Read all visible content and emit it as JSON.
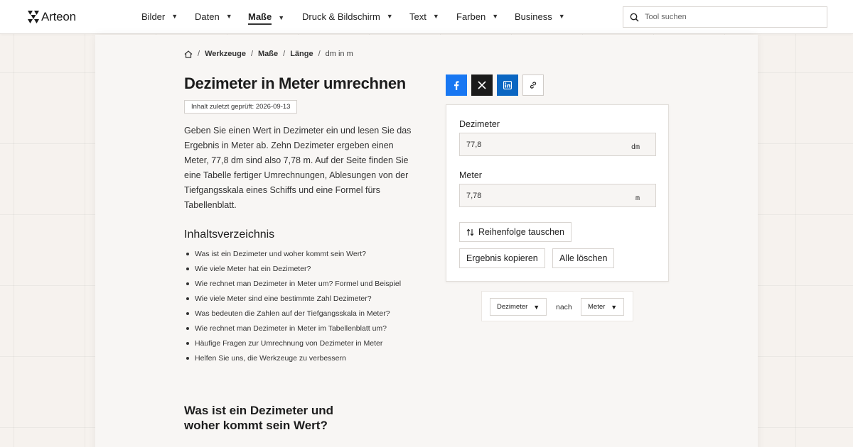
{
  "header": {
    "logo_text": "Arteon",
    "nav": [
      {
        "label": "Bilder",
        "active": false
      },
      {
        "label": "Daten",
        "active": false
      },
      {
        "label": "Maße",
        "active": true
      },
      {
        "label": "Druck & Bildschirm",
        "active": false
      },
      {
        "label": "Text",
        "active": false
      },
      {
        "label": "Farben",
        "active": false
      },
      {
        "label": "Business",
        "active": false
      }
    ],
    "search_placeholder": "Tool suchen"
  },
  "breadcrumb": [
    "Werkzeuge",
    "Maße",
    "Länge",
    "dm in m"
  ],
  "page": {
    "title": "Dezimeter in Meter umrechnen",
    "checked": "Inhalt zuletzt geprüft: 2026-09-13",
    "intro": "Geben Sie einen Wert in Dezimeter ein und lesen Sie das Ergebnis in Meter ab. Zehn Dezimeter ergeben einen Meter, 77,8 dm sind also 7,78 m. Auf der Seite finden Sie eine Tabelle fertiger Umrechnungen, Ablesungen von der Tiefgangsskala eines Schiffs und eine Formel fürs Tabellenblatt.",
    "toc_title": "Inhaltsverzeichnis",
    "toc": [
      "Was ist ein Dezimeter und woher kommt sein Wert?",
      "Wie viele Meter hat ein Dezimeter?",
      "Wie rechnet man Dezimeter in Meter um? Formel und Beispiel",
      "Wie viele Meter sind eine bestimmte Zahl Dezimeter?",
      "Was bedeuten die Zahlen auf der Tiefgangsskala in Meter?",
      "Wie rechnet man Dezimeter in Meter im Tabellenblatt um?",
      "Häufige Fragen zur Umrechnung von Dezimeter in Meter",
      "Helfen Sie uns, die Werkzeuge zu verbessern"
    ],
    "section_title": "Was ist ein Dezimeter und woher kommt sein Wert?"
  },
  "share": {
    "icons": [
      "facebook-icon",
      "x-icon",
      "linkedin-icon",
      "link-icon"
    ]
  },
  "converter": {
    "from_label": "Dezimeter",
    "from_value": "77,8",
    "from_unit": "dm",
    "to_label": "Meter",
    "to_value": "7,78",
    "to_unit": "m",
    "swap_label": "Reihenfolge tauschen",
    "copy_label": "Ergebnis kopieren",
    "clear_label": "Alle löschen"
  },
  "unit_selector": {
    "from": "Dezimeter",
    "connector": "nach",
    "to": "Meter"
  },
  "colors": {
    "facebook": "#1877f2",
    "x": "#1b1b1b",
    "linkedin": "#0a66c2"
  }
}
